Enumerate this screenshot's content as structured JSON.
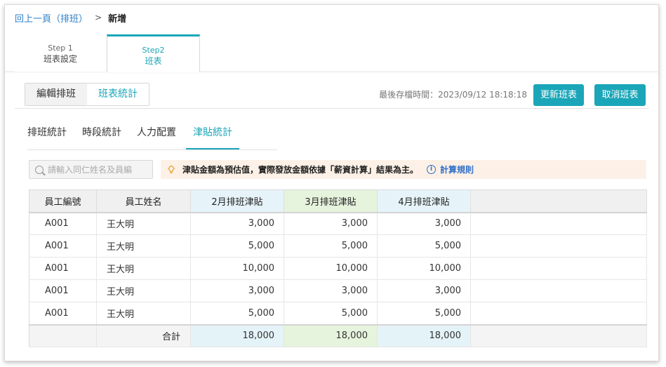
{
  "breadcrumb": {
    "back_link": "回上一頁（排班）",
    "separator": ">",
    "current": "新增"
  },
  "steps": [
    {
      "step": "Step 1",
      "title": "班表設定"
    },
    {
      "step": "Step2",
      "title": "班表"
    }
  ],
  "view_toggle": {
    "edit": "編輯排班",
    "stats": "班表統計"
  },
  "last_saved": "最後存檔時間：2023/09/12 18:18:18",
  "actions": {
    "update": "更新班表",
    "cancel": "取消班表"
  },
  "subtabs": [
    "排班統計",
    "時段統計",
    "人力配置",
    "津貼統計"
  ],
  "search": {
    "placeholder": "請輸入同仁姓名及員編"
  },
  "notice": {
    "text": "津貼金額為預估值，實際發放金額依據「薪資計算」結果為主。",
    "link": "計算規則"
  },
  "table": {
    "headers": [
      "員工編號",
      "員工姓名",
      "2月排班津貼",
      "3月排班津貼",
      "4月排班津貼"
    ],
    "rows": [
      [
        "A001",
        "王大明",
        "3,000",
        "3,000",
        "3,000"
      ],
      [
        "A001",
        "王大明",
        "5,000",
        "5,000",
        "5,000"
      ],
      [
        "A001",
        "王大明",
        "10,000",
        "10,000",
        "10,000"
      ],
      [
        "A001",
        "王大明",
        "3,000",
        "3,000",
        "3,000"
      ],
      [
        "A001",
        "王大明",
        "5,000",
        "5,000",
        "5,000"
      ]
    ],
    "total_label": "合計",
    "totals": [
      "18,000",
      "18,000",
      "18,000"
    ]
  },
  "colors": {
    "accent": "#1aa6b8",
    "link": "#2f80c8",
    "notice_bg": "#fdf1e7"
  }
}
